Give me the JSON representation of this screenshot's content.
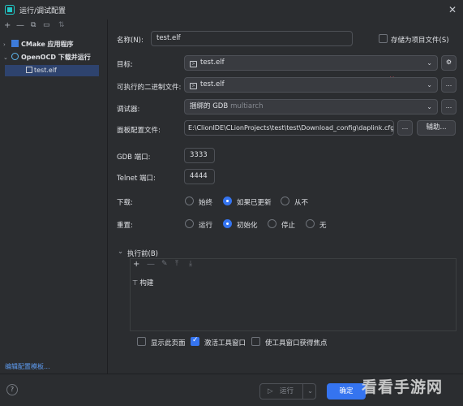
{
  "window": {
    "title": "运行/调试配置",
    "close_icon": "close-icon"
  },
  "sidebar": {
    "toolbar": [
      "add-icon",
      "remove-icon",
      "copy-icon",
      "folder-icon",
      "sort-icon"
    ],
    "items": [
      {
        "label": "CMake 应用程序",
        "expanded": false
      },
      {
        "label": "OpenOCD 下载并运行",
        "expanded": true
      },
      {
        "label": "test.elf",
        "selected": true
      }
    ],
    "edit_templates_link": "编辑配置模板..."
  },
  "form": {
    "name_label": "名称(N):",
    "name_value": "test.elf",
    "store_as_file_label": "存储为项目文件(S)",
    "target_label": "目标:",
    "target_value": "test.elf",
    "executable_label": "可执行的二进制文件:",
    "executable_value": "test.elf",
    "debugger_label": "调试器:",
    "debugger_value": "捆绑的 GDB",
    "debugger_hint": "multiarch",
    "board_config_label": "面板配置文件:",
    "board_config_value": "E:\\ClionIDE\\CLionProjects\\test\\test\\Download_config\\daplink.cfg",
    "assist_button": "辅助...",
    "browse_button": "...",
    "gdb_port_label": "GDB 端口:",
    "gdb_port_value": "3333",
    "telnet_port_label": "Telnet 端口:",
    "telnet_port_value": "4444",
    "download_label": "下载:",
    "download_options": [
      "始终",
      "如果已更新",
      "从不"
    ],
    "download_selected": "如果已更新",
    "reset_label": "重置:",
    "reset_options": [
      "运行",
      "初始化",
      "停止",
      "无"
    ],
    "reset_selected": "初始化"
  },
  "before_launch": {
    "header": "执行前(B)",
    "items": [
      "构建"
    ]
  },
  "options": {
    "show_page": "显示此页面",
    "activate_tool_window": "激活工具窗口",
    "focus_tool_window": "使工具窗口获得焦点",
    "activate_checked": true
  },
  "footer": {
    "run_label": "运行",
    "ok_label": "确定",
    "help": "?"
  },
  "watermark": "看看手游网",
  "colors": {
    "background": "#2b2d30",
    "accent": "#3574f0",
    "link": "#5e9bf0"
  }
}
